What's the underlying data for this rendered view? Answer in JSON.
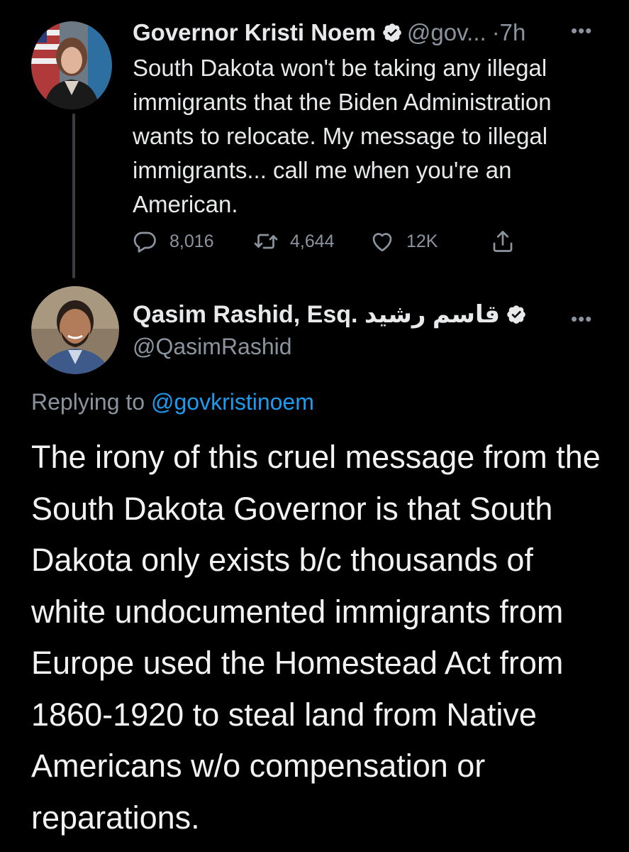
{
  "tweet1": {
    "author_name": "Governor Kristi Noem",
    "handle": "@gov...",
    "timestamp": "·7h",
    "text": "South Dakota won't be taking any illegal immigrants that the Biden Administration wants to relocate. My message to illegal immigrants... call me when you're an American.",
    "replies": "8,016",
    "retweets": "4,644",
    "likes": "12K"
  },
  "tweet2": {
    "author_name": "Qasim Rashid, Esq. قاسم رشيد",
    "handle": "@QasimRashid",
    "replying_prefix": "Replying to",
    "replying_to": "@govkristinoem",
    "text": "The irony of this cruel message from the South Dakota Governor is that South Dakota only exists b/c thousands of white undocumented immigrants from Europe used the Homestead Act from 1860-1920 to steal land from Native Americans w/o compensation or reparations."
  },
  "colors": {
    "background": "#000000",
    "text": "#e7e9ea",
    "muted": "#8b949e",
    "link": "#1d9bf0"
  },
  "icons": [
    "reply-icon",
    "retweet-icon",
    "like-icon",
    "share-icon",
    "verified-icon",
    "more-icon"
  ]
}
